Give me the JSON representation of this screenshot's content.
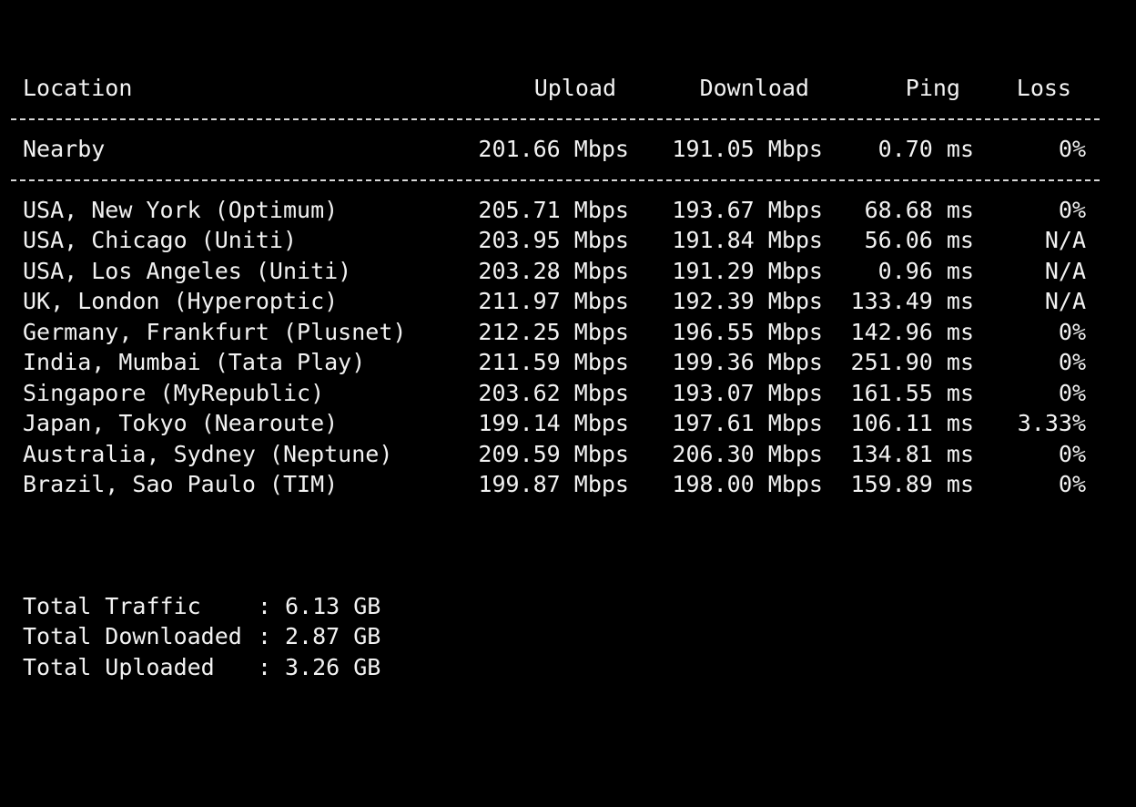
{
  "header": {
    "location": "Location",
    "upload": "Upload",
    "download": "Download",
    "ping": "Ping",
    "loss": "Loss"
  },
  "nearby": {
    "location": "Nearby",
    "upload": "201.66 Mbps",
    "download": "191.05 Mbps",
    "ping": "0.70 ms",
    "loss": "0%"
  },
  "results": [
    {
      "location": "USA, New York (Optimum)",
      "upload": "205.71 Mbps",
      "download": "193.67 Mbps",
      "ping": "68.68 ms",
      "loss": "0%"
    },
    {
      "location": "USA, Chicago (Uniti)",
      "upload": "203.95 Mbps",
      "download": "191.84 Mbps",
      "ping": "56.06 ms",
      "loss": "N/A"
    },
    {
      "location": "USA, Los Angeles (Uniti)",
      "upload": "203.28 Mbps",
      "download": "191.29 Mbps",
      "ping": "0.96 ms",
      "loss": "N/A"
    },
    {
      "location": "UK, London (Hyperoptic)",
      "upload": "211.97 Mbps",
      "download": "192.39 Mbps",
      "ping": "133.49 ms",
      "loss": "N/A"
    },
    {
      "location": "Germany, Frankfurt (Plusnet)",
      "upload": "212.25 Mbps",
      "download": "196.55 Mbps",
      "ping": "142.96 ms",
      "loss": "0%"
    },
    {
      "location": "India, Mumbai (Tata Play)",
      "upload": "211.59 Mbps",
      "download": "199.36 Mbps",
      "ping": "251.90 ms",
      "loss": "0%"
    },
    {
      "location": "Singapore (MyRepublic)",
      "upload": "203.62 Mbps",
      "download": "193.07 Mbps",
      "ping": "161.55 ms",
      "loss": "0%"
    },
    {
      "location": "Japan, Tokyo (Nearoute)",
      "upload": "199.14 Mbps",
      "download": "197.61 Mbps",
      "ping": "106.11 ms",
      "loss": "3.33%"
    },
    {
      "location": "Australia, Sydney (Neptune)",
      "upload": "209.59 Mbps",
      "download": "206.30 Mbps",
      "ping": "134.81 ms",
      "loss": "0%"
    },
    {
      "location": "Brazil, Sao Paulo (TIM)",
      "upload": "199.87 Mbps",
      "download": "198.00 Mbps",
      "ping": "159.89 ms",
      "loss": "0%"
    }
  ],
  "summary": [
    {
      "label": "Total Traffic",
      "separator": ":",
      "value": "6.13 GB"
    },
    {
      "label": "Total Downloaded",
      "separator": ":",
      "value": "2.87 GB"
    },
    {
      "label": "Total Uploaded",
      "separator": ":",
      "value": "3.26 GB"
    }
  ],
  "colors": {
    "background": "#000000",
    "text": "#f2f2f2"
  }
}
